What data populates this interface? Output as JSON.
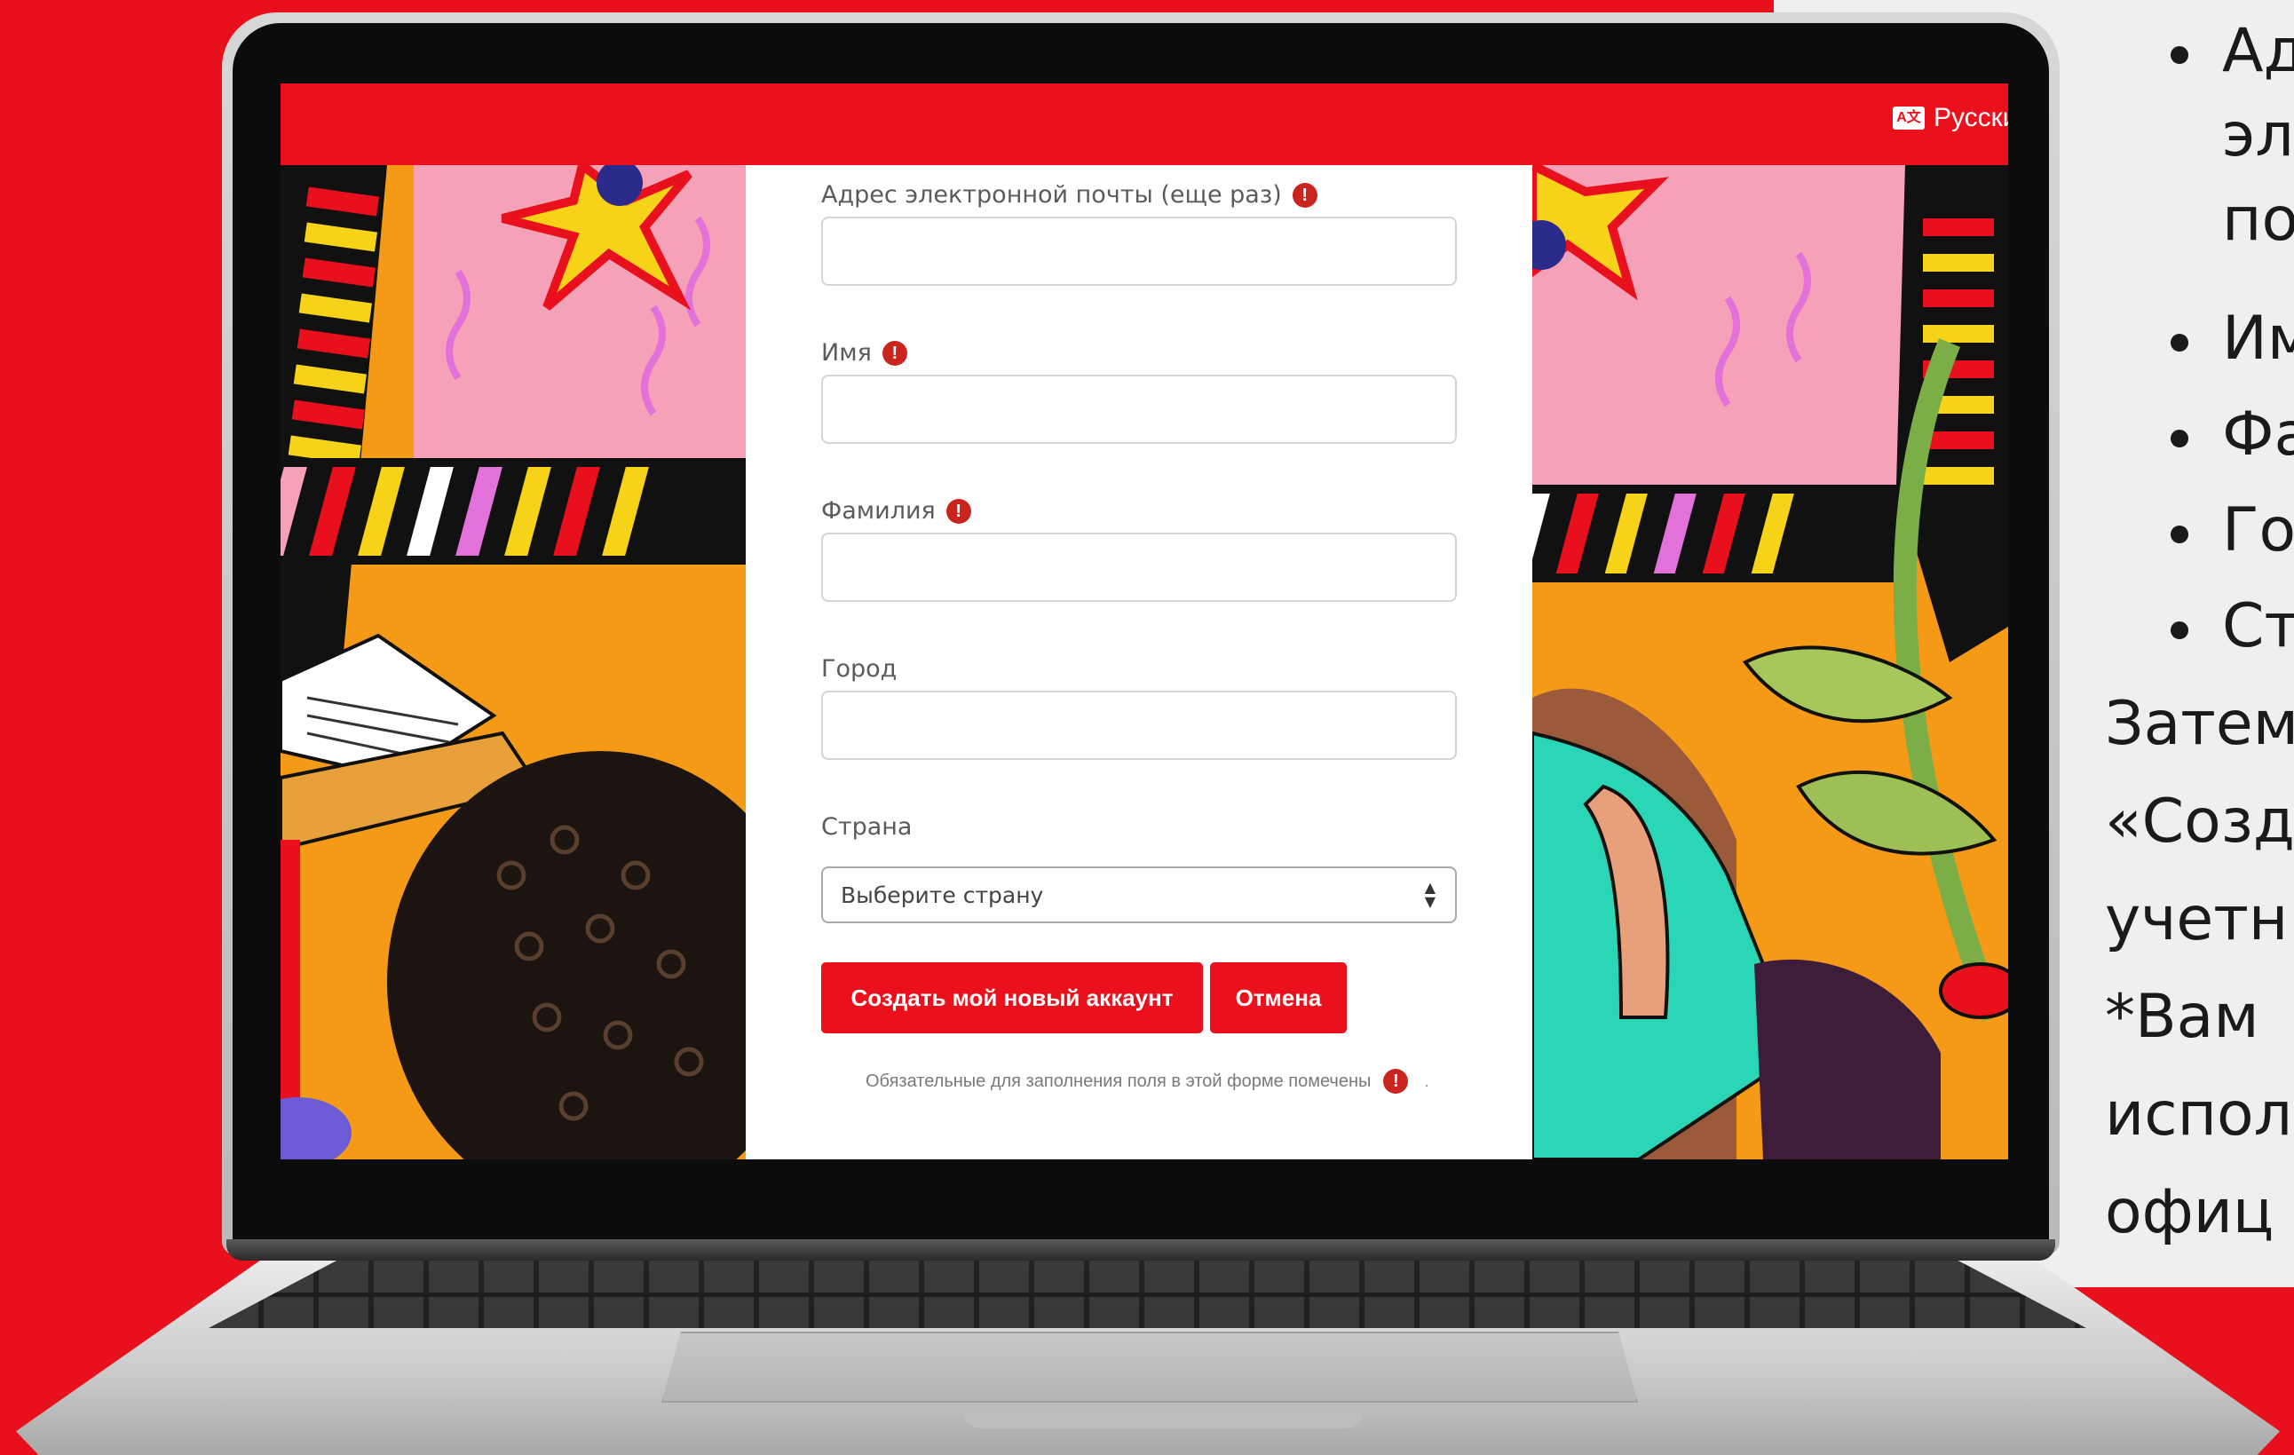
{
  "side_text": {
    "bullets": [
      [
        "Ад",
        "эл",
        "по"
      ],
      [
        "Им"
      ],
      [
        "Фа"
      ],
      [
        "Го"
      ],
      [
        "Ст"
      ]
    ],
    "paragraph": [
      "Затем",
      "«Созд",
      "учетн",
      "*Вам",
      "испол",
      "офиц"
    ]
  },
  "header": {
    "language_label": "Русски",
    "language_icon": "translate-icon"
  },
  "form": {
    "email_again_label": "Адрес электронной почты (еще раз)",
    "first_name_label": "Имя",
    "last_name_label": "Фамилия",
    "city_label": "Город",
    "country_label": "Страна",
    "country_selected": "Выберите страну",
    "required_icon": "!",
    "create_button": "Создать мой новый аккаунт",
    "cancel_button": "Отмена",
    "required_note": "Обязательные для заполнения поля в этой форме помечены",
    "required_note_end": "."
  },
  "colors": {
    "brand_red": "#ea101c",
    "required_red": "#c9241d"
  }
}
